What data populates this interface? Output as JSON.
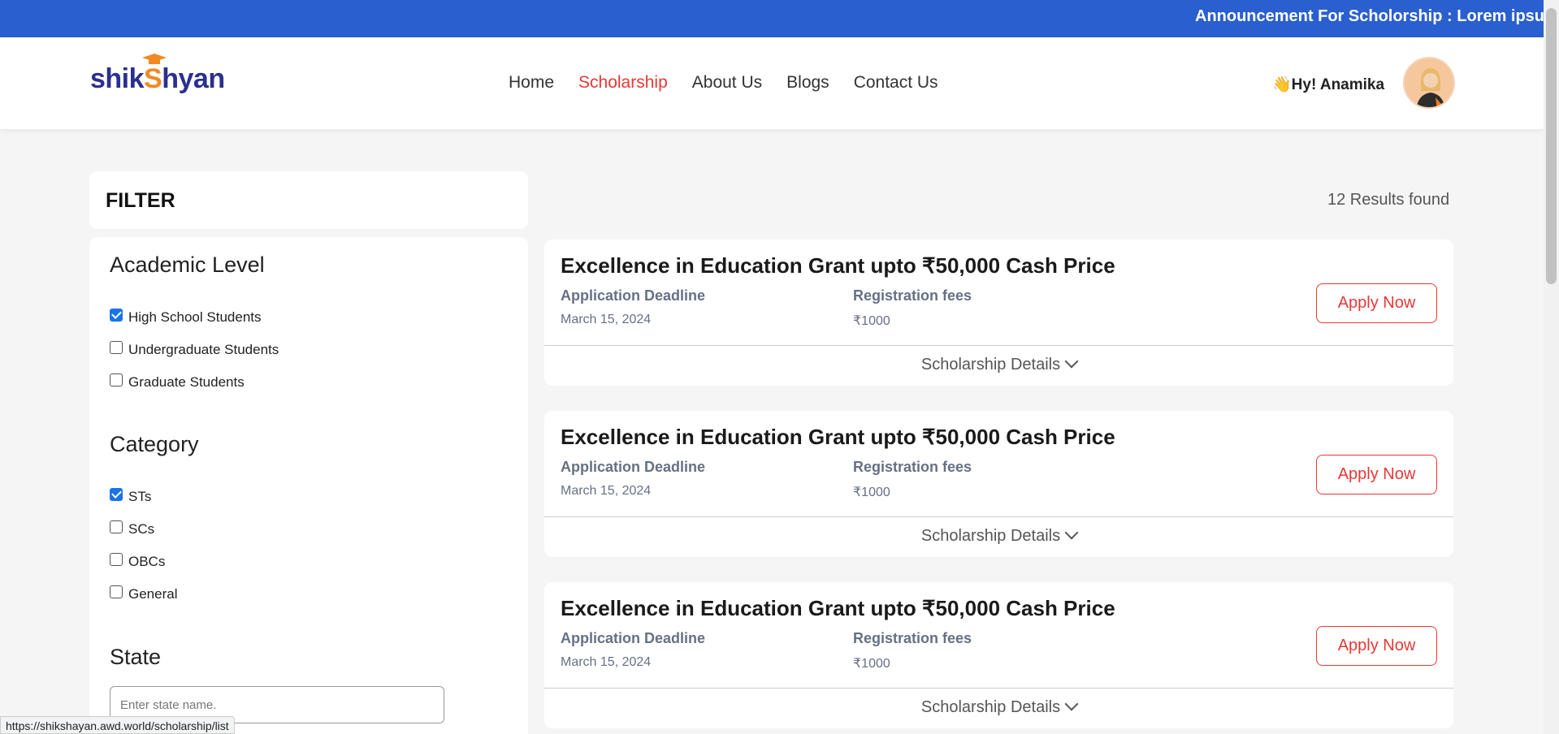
{
  "announcement": {
    "text": "Announcement For Scholorship : Lorem ipsum"
  },
  "header": {
    "logo": {
      "part1": "shik",
      "part2": "S",
      "part3": "hyan"
    },
    "nav": [
      {
        "label": "Home",
        "active": false
      },
      {
        "label": "Scholarship",
        "active": true
      },
      {
        "label": "About Us",
        "active": false
      },
      {
        "label": "Blogs",
        "active": false
      },
      {
        "label": "Contact Us",
        "active": false
      }
    ],
    "greeting": "👋Hy! Anamika"
  },
  "filter": {
    "title": "FILTER",
    "academic": {
      "heading": "Academic Level",
      "options": [
        {
          "label": "High School Students",
          "checked": true
        },
        {
          "label": "Undergraduate Students",
          "checked": false
        },
        {
          "label": "Graduate Students",
          "checked": false
        }
      ]
    },
    "category": {
      "heading": "Category",
      "options": [
        {
          "label": "STs",
          "checked": true
        },
        {
          "label": "SCs",
          "checked": false
        },
        {
          "label": "OBCs",
          "checked": false
        },
        {
          "label": "General",
          "checked": false
        }
      ]
    },
    "state": {
      "heading": "State",
      "placeholder": "Enter state name."
    }
  },
  "results": {
    "text": "12 Results found"
  },
  "scholarships": [
    {
      "title": "Excellence in Education Grant upto ₹50,000 Cash Price",
      "deadline_label": "Application Deadline",
      "deadline": "March 15, 2024",
      "fees_label": "Registration fees",
      "fees": "₹1000",
      "apply_label": "Apply Now",
      "details_label": "Scholarship Details"
    },
    {
      "title": "Excellence in Education Grant upto ₹50,000 Cash Price",
      "deadline_label": "Application Deadline",
      "deadline": "March 15, 2024",
      "fees_label": "Registration fees",
      "fees": "₹1000",
      "apply_label": "Apply Now",
      "details_label": "Scholarship Details"
    },
    {
      "title": "Excellence in Education Grant upto ₹50,000 Cash Price",
      "deadline_label": "Application Deadline",
      "deadline": "March 15, 2024",
      "fees_label": "Registration fees",
      "fees": "₹1000",
      "apply_label": "Apply Now",
      "details_label": "Scholarship Details"
    }
  ],
  "status_bar": {
    "url": "https://shikshayan.awd.world/scholarship/list"
  },
  "colors": {
    "brand_blue": "#2a5fcf",
    "accent_red": "#e53935",
    "logo_navy": "#2b2f8f",
    "logo_orange": "#f08a24"
  }
}
